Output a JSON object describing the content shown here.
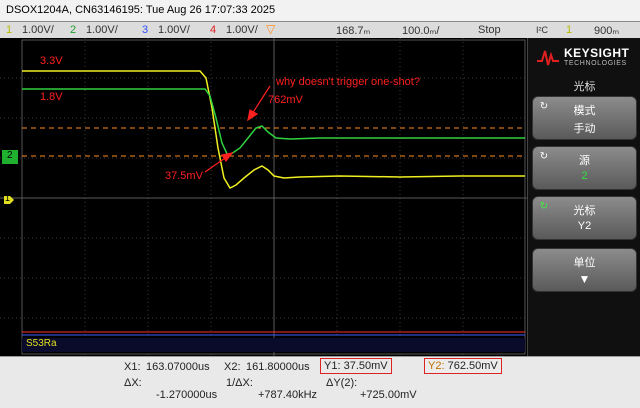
{
  "titlebar": {
    "text": "DSOX1204A, CN63146195: Tue Aug 26 17:07:33 2025"
  },
  "channel_bar": {
    "ch1_num": "1",
    "ch1_scale": "1.00V/",
    "ch2_num": "2",
    "ch2_scale": "1.00V/",
    "ch3_num": "3",
    "ch3_scale": "1.00V/",
    "ch4_num": "4",
    "ch4_scale": "1.00V/",
    "delay": "168.7ₘ",
    "timebase": "100.0ₘ/",
    "run_state": "Stop",
    "trigger_label": "I²C",
    "trigger_ch": "1",
    "trigger_level": "900ₘ"
  },
  "screen": {
    "annotation_question": "why doesn't trigger one-shot?",
    "annotation_3v3": "3.3V",
    "annotation_1v8": "1.8V",
    "annotation_762": "762mV",
    "annotation_375": "37.5mV",
    "decode_label": "S53Ra",
    "ch2_marker": "2",
    "ch1_marker": "1",
    "colors": {
      "ch1": "#f0f020",
      "ch2": "#30d040",
      "ch3": "#4060ff",
      "ch4": "#ff3030",
      "cursor": "#ff9020",
      "annotation": "#ff2020"
    }
  },
  "sidepanel": {
    "brand_name": "KEYSIGHT",
    "brand_sub": "TECHNOLOGIES",
    "menu_title": "光标",
    "key1": {
      "line1": "模式",
      "line2": "手动"
    },
    "key2": {
      "line1": "源",
      "line2": "2"
    },
    "key3": {
      "line1": "光标",
      "line2": "Y2"
    },
    "key4": {
      "line1": "单位",
      "line2": ""
    }
  },
  "bottom": {
    "x1_label": "X1:",
    "x1_value": "163.07000us",
    "x2_label": "X2:",
    "x2_value": "161.80000us",
    "y1_label": "Y1:",
    "y1_value": "37.50mV",
    "y2_label": "Y2:",
    "y2_value": "762.50mV",
    "dx_label": "ΔX:",
    "dx_value": "-1.270000us",
    "inv_dx_label": "1/ΔX:",
    "inv_dx_value": "+787.40kHz",
    "dy_label": "ΔY(2):",
    "dy_value": "+725.00mV"
  }
}
